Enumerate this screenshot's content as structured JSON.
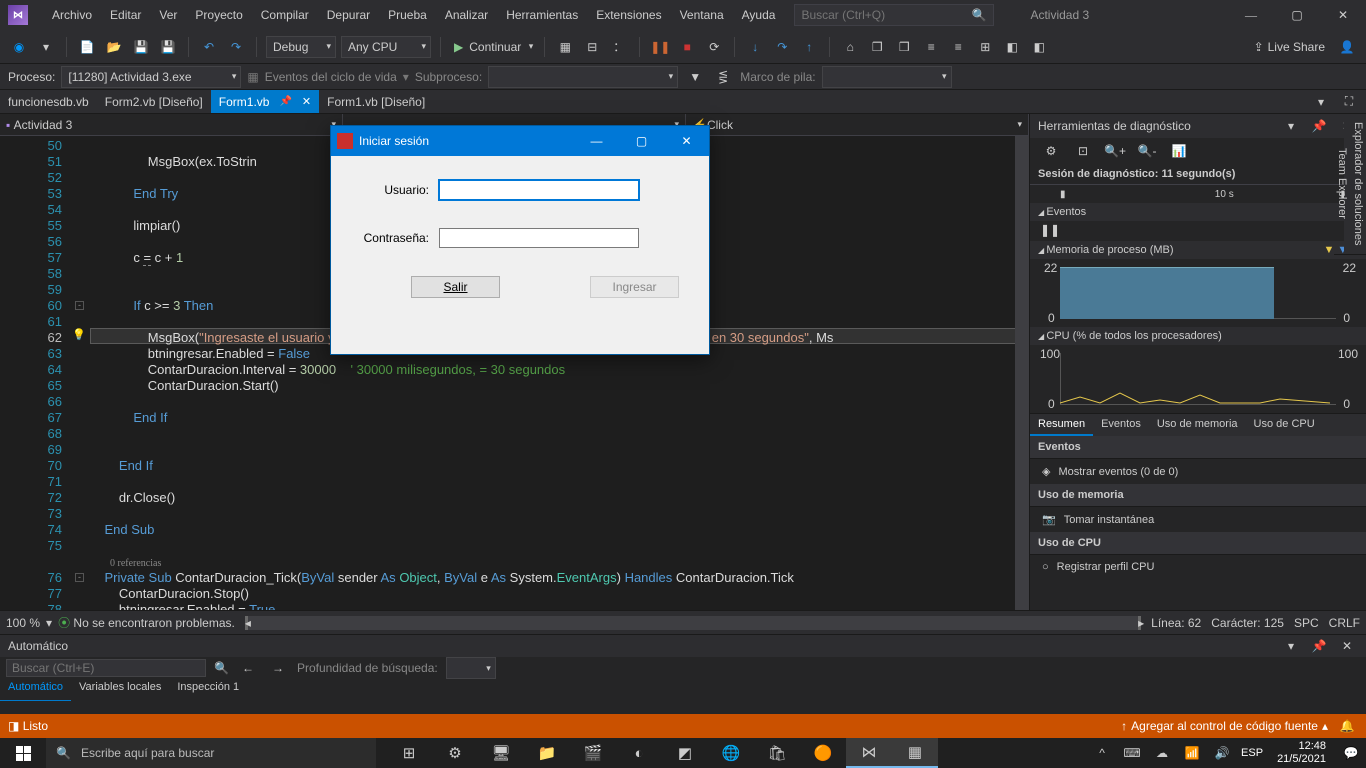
{
  "title_solution": "Actividad 3",
  "menu": [
    "Archivo",
    "Editar",
    "Ver",
    "Proyecto",
    "Compilar",
    "Depurar",
    "Prueba",
    "Analizar",
    "Herramientas",
    "Extensiones",
    "Ventana",
    "Ayuda"
  ],
  "search_placeholder": "Buscar (Ctrl+Q)",
  "config": "Debug",
  "platform": "Any CPU",
  "continue": "Continuar",
  "live_share": "Live Share",
  "process_label": "Proceso:",
  "process_value": "[11280] Actividad 3.exe",
  "lifecycle": "Eventos del ciclo de vida",
  "subprocess": "Subproceso:",
  "stackframe": "Marco de pila:",
  "tabs": [
    {
      "label": "funcionesdb.vb",
      "active": false
    },
    {
      "label": "Form2.vb [Diseño]",
      "active": false
    },
    {
      "label": "Form1.vb",
      "active": true,
      "pinned": true
    },
    {
      "label": "Form1.vb [Diseño]",
      "active": false
    }
  ],
  "dropdown_left": "Actividad 3",
  "dropdown_right": "Click",
  "code_lines": [
    {
      "n": 50
    },
    {
      "n": 51,
      "t": "                MsgBox(ex.ToStrin"
    },
    {
      "n": 52
    },
    {
      "n": 53,
      "t": "            End Try",
      "k": [
        "End",
        "Try"
      ]
    },
    {
      "n": 54
    },
    {
      "n": 55,
      "t": "            limpiar()"
    },
    {
      "n": 56
    },
    {
      "n": 57,
      "t": "            c = c + 1",
      "u": "="
    },
    {
      "n": 58
    },
    {
      "n": 59
    },
    {
      "n": 60,
      "t": "            If c >= 3 Then",
      "k": [
        "If",
        "Then"
      ]
    },
    {
      "n": 61
    },
    {
      "n": 62,
      "hl": true,
      "t": "                MsgBox(\"Ingresaste el usuario y/o contraseña incorrectamente mas de 3 veces, intente de nuevo en 30 segundos\", Ms"
    },
    {
      "n": 63,
      "t": "                btningresar.Enabled = False",
      "k": [
        "False"
      ]
    },
    {
      "n": 64,
      "t": "                ContarDuracion.Interval = 30000    ' 30000 milisegundos, = 30 segundos"
    },
    {
      "n": 65,
      "t": "                ContarDuracion.Start()"
    },
    {
      "n": 66
    },
    {
      "n": 67,
      "t": "            End If",
      "k": [
        "End",
        "If"
      ]
    },
    {
      "n": 68
    },
    {
      "n": 69
    },
    {
      "n": 70,
      "t": "        End If",
      "k": [
        "End",
        "If"
      ]
    },
    {
      "n": 71
    },
    {
      "n": 72,
      "t": "        dr.Close()"
    },
    {
      "n": 73
    },
    {
      "n": 74,
      "t": "    End Sub",
      "k": [
        "End",
        "Sub"
      ]
    },
    {
      "n": 75
    },
    {
      "nref": "0 referencias"
    },
    {
      "n": 76,
      "t": "    Private Sub ContarDuracion_Tick(ByVal sender As Object, ByVal e As System.EventArgs) Handles ContarDuracion.Tick"
    },
    {
      "n": 77,
      "t": "        ContarDuracion.Stop()"
    },
    {
      "n": 78,
      "t": "        btningresar.Enabled = True",
      "k": [
        "True"
      ]
    }
  ],
  "editor_status": {
    "zoom": "100 %",
    "problems": "No se encontraron problemas.",
    "line": "Línea: 62",
    "col": "Carácter: 125",
    "spc": "SPC",
    "crlf": "CRLF"
  },
  "diag": {
    "title": "Herramientas de diagnóstico",
    "session": "Sesión de diagnóstico: 11 segundo(s)",
    "ruler": "10 s",
    "events": "Eventos",
    "memory": "Memoria de proceso (MB)",
    "mem_val": "22",
    "mem_zero": "0",
    "cpu": "CPU (% de todos los procesadores)",
    "cpu_hi": "100",
    "cpu_lo": "0",
    "tabs": [
      "Resumen",
      "Eventos",
      "Uso de memoria",
      "Uso de CPU"
    ],
    "sections": {
      "events_h": "Eventos",
      "events_i": "Mostrar eventos (0 de 0)",
      "mem_h": "Uso de memoria",
      "mem_i": "Tomar instantánea",
      "cpu_h": "Uso de CPU",
      "cpu_i": "Registrar perfil CPU"
    }
  },
  "side_tabs": [
    "Explorador de soluciones",
    "Team Explorer"
  ],
  "auto_panel": {
    "title": "Automático",
    "search": "Buscar (Ctrl+E)",
    "depth": "Profundidad de búsqueda:",
    "tabs": [
      "Automático",
      "Variables locales",
      "Inspección 1"
    ]
  },
  "vs_status": {
    "ready": "Listo",
    "scm": "Agregar al control de código fuente"
  },
  "login": {
    "title": "Iniciar sesión",
    "user": "Usuario:",
    "pass": "Contraseña:",
    "exit": "Salir",
    "enter": "Ingresar"
  },
  "taskbar": {
    "search": "Escribe aquí para buscar",
    "lang": "ESP",
    "time": "12:48",
    "date": "21/5/2021"
  }
}
